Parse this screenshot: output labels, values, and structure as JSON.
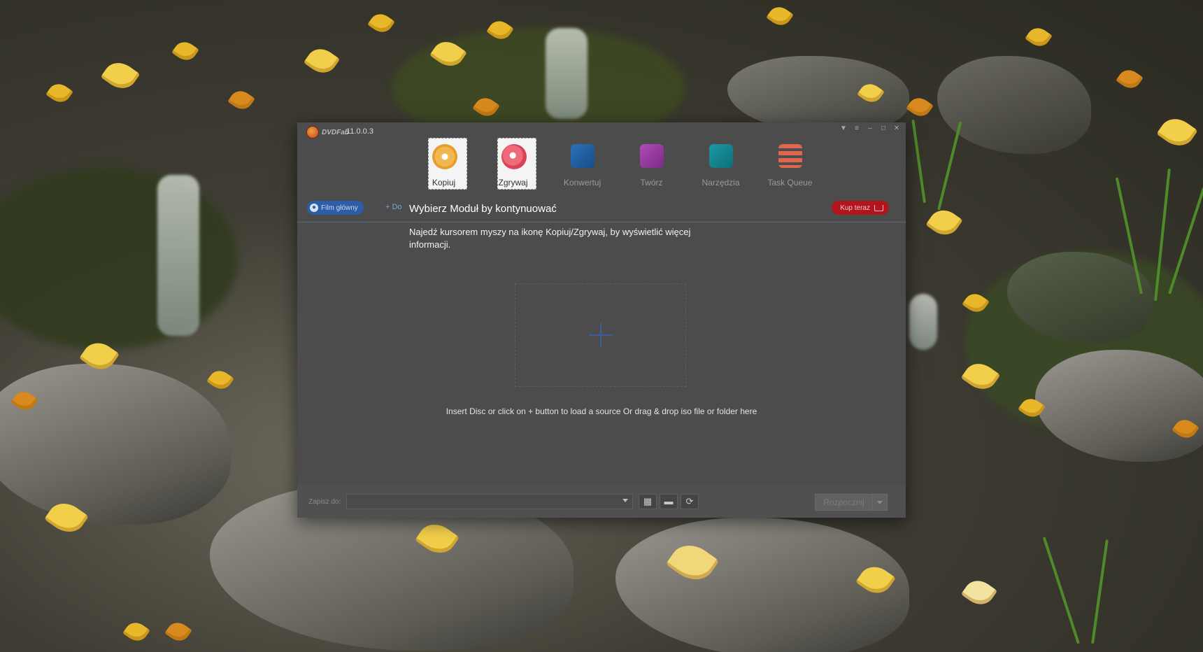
{
  "window": {
    "logo_text": "DVDFab",
    "version": "11.0.0.3"
  },
  "modules": [
    {
      "label": "Kopiuj",
      "icon": "disc-copy-icon"
    },
    {
      "label": "Zgrywaj",
      "icon": "disc-rip-icon"
    },
    {
      "label": "Konwertuj",
      "icon": "film-convert-icon"
    },
    {
      "label": "Twórz",
      "icon": "video-create-icon"
    },
    {
      "label": "Narzędzia",
      "icon": "toolbox-icon"
    },
    {
      "label": "Task Queue",
      "icon": "queue-icon"
    }
  ],
  "navbar": {
    "home_label": "Film główny",
    "add_label": "Do",
    "title": "Wybierz Moduł by kontynuować",
    "buy_label": "Kup teraz"
  },
  "main": {
    "hint": "Najedź kursorem myszy na ikonę Kopiuj/Zgrywaj, by wyświetlić więcej informacji.",
    "drop_message": "Insert Disc or click on + button to load a source Or drag & drop iso file or folder here"
  },
  "footer": {
    "save_label": "Zapisz do:",
    "save_value": "",
    "start_label": "Rozpocznij"
  },
  "colors": {
    "window_bg": "#4c4c4c",
    "home_button": "#2d5da8",
    "buy_button": "#b3151d",
    "plus_accent": "#3b5f9a"
  }
}
